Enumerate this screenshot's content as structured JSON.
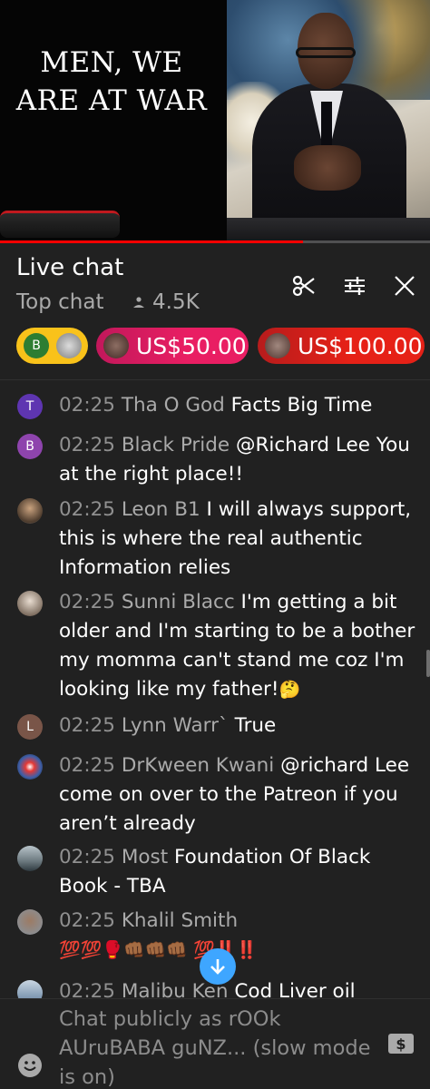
{
  "video": {
    "title_line1": "MEN, WE",
    "title_line2": "ARE AT WAR",
    "progress": 0.705
  },
  "header": {
    "title": "Live chat",
    "mode": "Top chat",
    "viewers": "4.5K"
  },
  "ticker": {
    "items": [
      {
        "letter": "B",
        "color": "#2e7d32",
        "bg": "#f9c21a"
      },
      {
        "amount": "US$50.00",
        "bg": "#e91e63"
      },
      {
        "amount": "US$100.00",
        "bg": "#e62117"
      }
    ]
  },
  "messages": [
    {
      "time": "02:25",
      "author": "Tha O God",
      "text": "Facts Big Time",
      "avatar_letter": "T",
      "avatar_color": "#5e35b1"
    },
    {
      "time": "02:25",
      "author": "Black Pride",
      "text": "@Richard Lee You at the right place!!",
      "avatar_letter": "B",
      "avatar_color": "#8e44ad"
    },
    {
      "time": "02:25",
      "author": "Leon B1",
      "text": "I will always support, this is where the real authentic Information relies",
      "avatar_letter": "",
      "avatar_color": "#9a9a9a"
    },
    {
      "time": "02:25",
      "author": "Sunni Blacc",
      "text": "I'm getting a bit older and I'm starting to be a bother my momma can't stand me coz I'm looking like my father!",
      "emoji": "🤔",
      "avatar_letter": "",
      "avatar_color": "#7a6a5c"
    },
    {
      "time": "02:25",
      "author": "Lynn Warr`",
      "text": "True",
      "avatar_letter": "L",
      "avatar_color": "#795548"
    },
    {
      "time": "02:25",
      "author": "DrKween Kwani",
      "text": "@richard Lee come on over to the Patreon if you aren’t already",
      "avatar_letter": "",
      "avatar_color": "#3e5fa8"
    },
    {
      "time": "02:25",
      "author": "Most",
      "text": "Foundation Of Black Book - TBA",
      "avatar_letter": "",
      "avatar_color": "#6d7a80"
    },
    {
      "time": "02:25",
      "author": "Khalil Smith",
      "text": "",
      "emoji": "💯💯🥊👊🏾👊🏾👊🏾 💯‼️‼️",
      "avatar_letter": "",
      "avatar_color": "#8a8f95"
    },
    {
      "time": "02:25",
      "author": "Malibu Ken",
      "text": "Cod Liver oil",
      "avatar_letter": "",
      "avatar_color": "#5f7d9c"
    }
  ],
  "composer": {
    "placeholder": "Chat publicly as rOOk AUruBABA guNZ... (slow mode is on)"
  },
  "colors": {
    "background": "#212121",
    "accent_red": "#ff0000",
    "jump_button": "#3ea6ff",
    "secondary_text": "#aaaaaa"
  },
  "icons": [
    "clip-icon",
    "filter-sliders-icon",
    "close-icon",
    "people-icon",
    "arrow-down-icon",
    "emoji-icon",
    "super-chat-icon"
  ]
}
